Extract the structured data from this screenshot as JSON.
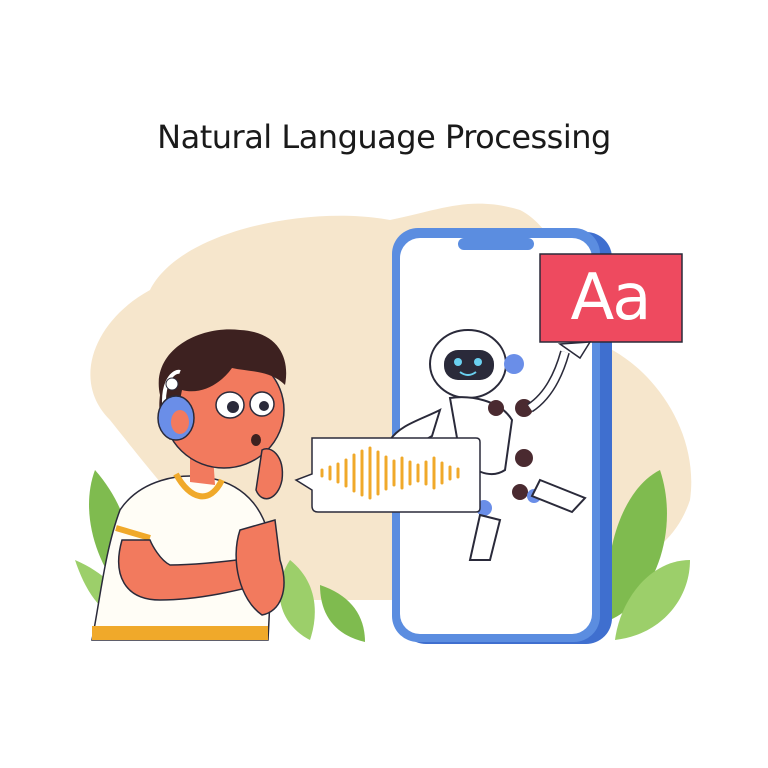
{
  "title": "Natural Language Processing",
  "badge": {
    "label": "Aa",
    "color": "#ee4a5f"
  },
  "colors": {
    "blob": "#f6e6cc",
    "phone_frame": "#5b8de0",
    "leaf": "#88c057",
    "skin": "#f27a5e",
    "hair": "#3d2120",
    "waveform": "#f0a92a"
  },
  "icons": [
    "headphones-icon",
    "sound-wave-icon",
    "robot-icon",
    "text-badge-icon"
  ]
}
